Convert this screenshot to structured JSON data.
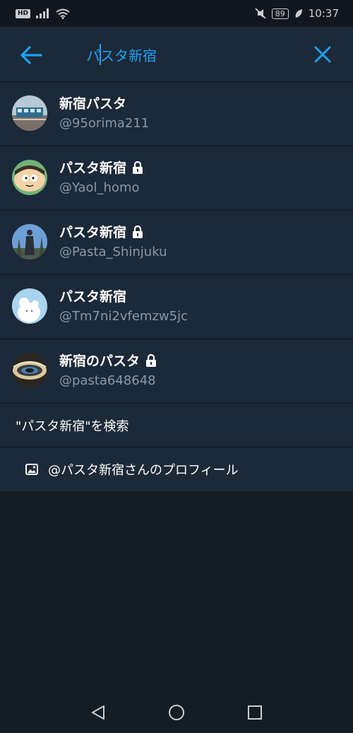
{
  "status_bar": {
    "hd": "HD",
    "battery": "89",
    "time": "10:37"
  },
  "search": {
    "query": "パスタ新宿"
  },
  "results": [
    {
      "name": "新宿パスタ",
      "handle": "@95orima211",
      "locked": false,
      "avatar": "train-photo"
    },
    {
      "name": "パスタ新宿",
      "handle": "@Yaol_homo",
      "locked": true,
      "avatar": "cartoon-face"
    },
    {
      "name": "パスタ新宿",
      "handle": "@Pasta_Shinjuku",
      "locked": true,
      "avatar": "statue-photo"
    },
    {
      "name": "パスタ新宿",
      "handle": "@Tm7ni2vfemzw5jc",
      "locked": false,
      "avatar": "white-creature"
    },
    {
      "name": "新宿のパスタ",
      "handle": "@pasta648648",
      "locked": true,
      "avatar": "eye-photo"
    }
  ],
  "search_action": "\"パスタ新宿\"を検索",
  "profile_action": "@パスタ新宿さんのプロフィール",
  "colors": {
    "accent": "#1da1f2",
    "panel": "#1c2938",
    "background": "#141d26",
    "secondary_text": "#8899a6"
  }
}
